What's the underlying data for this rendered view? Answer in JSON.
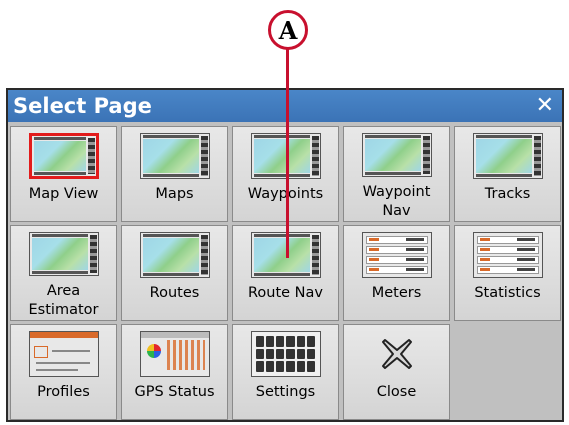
{
  "callout": {
    "label": "A"
  },
  "dialog": {
    "title": "Select Page",
    "close_glyph": "✕",
    "tiles": [
      {
        "label": "Map View",
        "icon": "map-view-icon",
        "selected": true
      },
      {
        "label": "Maps",
        "icon": "maps-icon"
      },
      {
        "label": "Waypoints",
        "icon": "waypoints-icon"
      },
      {
        "label": "Waypoint\nNav",
        "icon": "waypoint-nav-icon"
      },
      {
        "label": "Tracks",
        "icon": "tracks-icon"
      },
      {
        "label": "Area\nEstimator",
        "icon": "area-estimator-icon"
      },
      {
        "label": "Routes",
        "icon": "routes-icon"
      },
      {
        "label": "Route Nav",
        "icon": "route-nav-icon"
      },
      {
        "label": "Meters",
        "icon": "meters-icon"
      },
      {
        "label": "Statistics",
        "icon": "statistics-icon"
      },
      {
        "label": "Profiles",
        "icon": "profiles-icon"
      },
      {
        "label": "GPS Status",
        "icon": "gps-status-icon"
      },
      {
        "label": "Settings",
        "icon": "settings-icon"
      },
      {
        "label": "Close",
        "icon": "close-icon"
      }
    ]
  },
  "colors": {
    "titlebar": "#3b73b6",
    "callout": "#c8102e",
    "selected_outline": "#e21b1b"
  }
}
